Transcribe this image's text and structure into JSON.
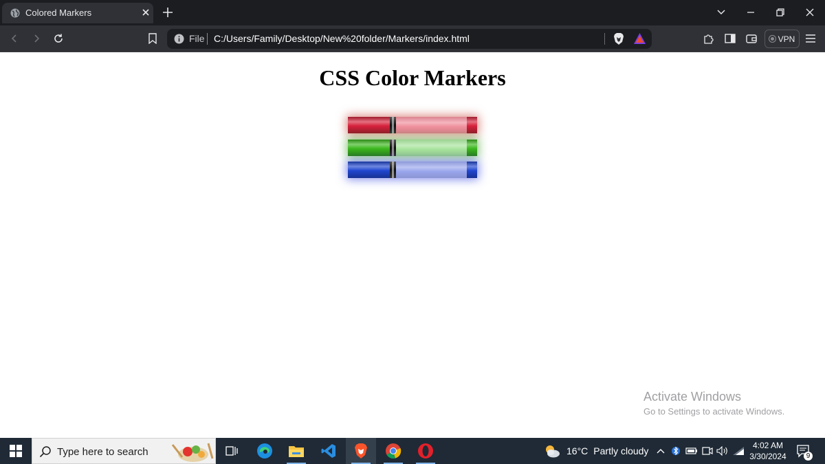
{
  "browser": {
    "tab": {
      "title": "Colored Markers"
    },
    "address": {
      "scheme_label": "File",
      "url": "C:/Users/Family/Desktop/New%20folder/Markers/index.html"
    },
    "vpn_label": "VPN"
  },
  "page": {
    "heading": "CSS Color Markers",
    "markers": [
      {
        "name": "red",
        "body_color": "#d6233c",
        "cap_color": "#ef8f9c",
        "tip_color": "#d6233c",
        "glow": "#c0392b"
      },
      {
        "name": "green",
        "body_color": "#3cb81f",
        "cap_color": "#a7e39c",
        "tip_color": "#3cb81f",
        "glow": "#3aa020"
      },
      {
        "name": "blue",
        "body_color": "#2147d0",
        "cap_color": "#9aa6ec",
        "tip_color": "#2147d0",
        "glow": "#2e3fe0"
      }
    ]
  },
  "watermark": {
    "line1": "Activate Windows",
    "line2": "Go to Settings to activate Windows."
  },
  "taskbar": {
    "search_placeholder": "Type here to search",
    "weather": {
      "temp": "16°C",
      "condition": "Partly cloudy"
    },
    "clock": {
      "time": "4:02 AM",
      "date": "3/30/2024"
    },
    "notifications_count": "9"
  }
}
